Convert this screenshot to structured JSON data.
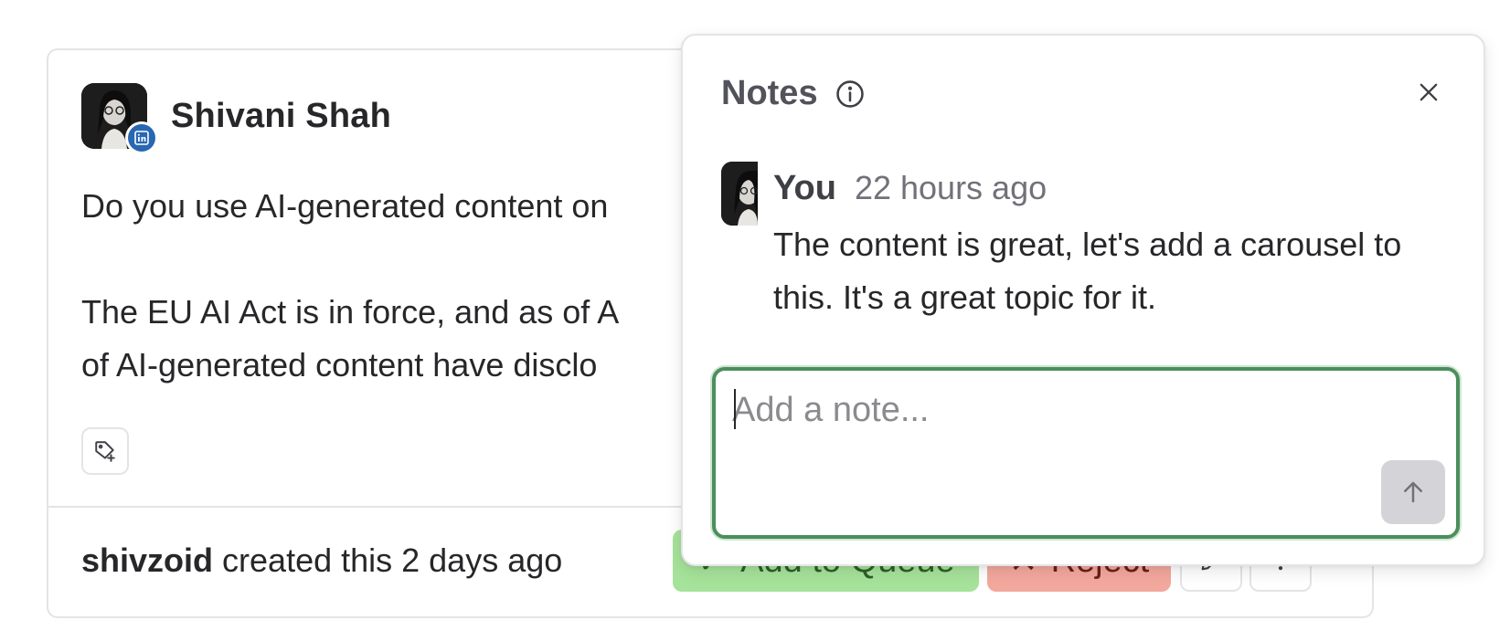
{
  "post": {
    "author_name": "Shivani Shah",
    "platform_icon": "linkedin-icon",
    "paragraphs": [
      "Do you use AI-generated content on",
      "The EU AI Act is in force, and as of A\nof AI-generated content have disclo"
    ],
    "paragraph_1": "Do you use AI-generated content on",
    "paragraph_2_line_1": "The EU AI Act is in force, and as of A",
    "paragraph_2_line_2": "of AI-generated content have disclo",
    "footer_user": "shivzoid",
    "footer_text": " created this 2 days ago",
    "actions": {
      "queue_label": "Add to Queue",
      "reject_label": "Reject"
    }
  },
  "notes": {
    "title": "Notes",
    "items": [
      {
        "author": "You",
        "time": "22 hours ago",
        "text": "The content is great, let's add a carousel to this. It's a great topic for it."
      }
    ],
    "input_placeholder": "Add a note...",
    "input_value": ""
  },
  "colors": {
    "queue_bg": "#a6e39a",
    "reject_bg": "#f3a89e",
    "focus_ring": "#4b8f5c",
    "linkedin_blue": "#2867b2"
  }
}
